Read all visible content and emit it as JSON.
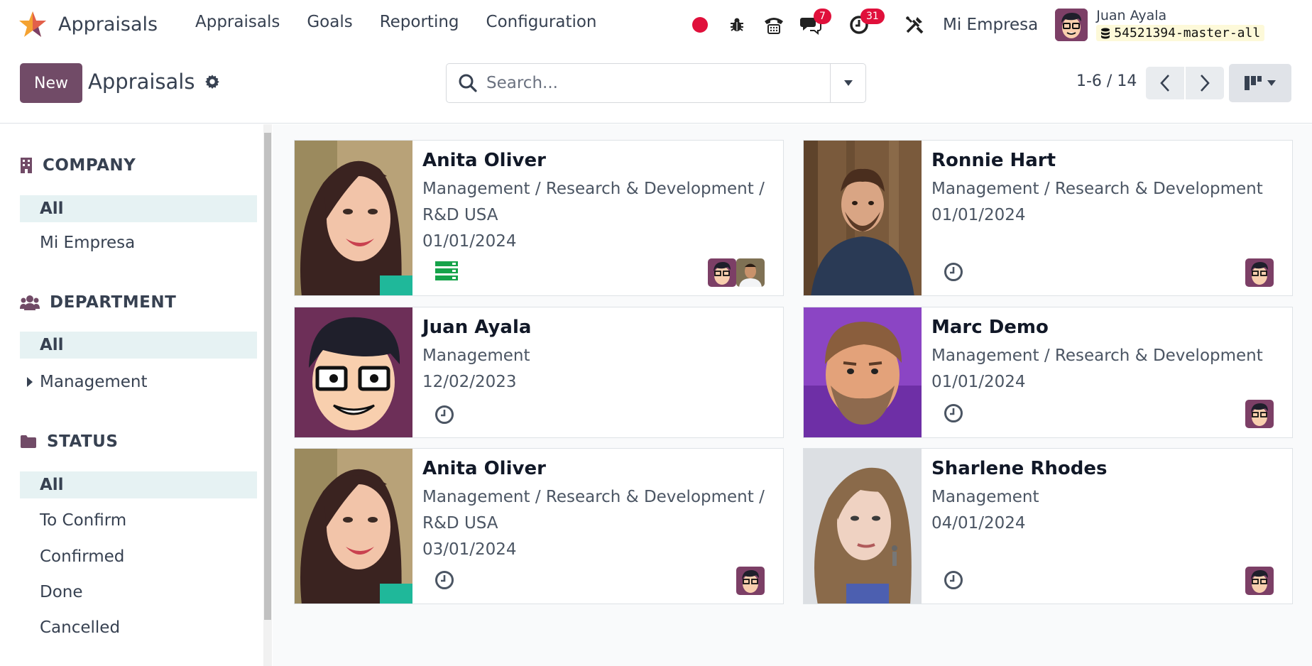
{
  "navbar": {
    "app_name": "Appraisals",
    "menu": [
      "Appraisals",
      "Goals",
      "Reporting",
      "Configuration"
    ],
    "messages_count": "7",
    "activities_count": "31",
    "company": "Mi Empresa",
    "user_name": "Juan Ayala",
    "database": "54521394-master-all"
  },
  "control": {
    "new_label": "New",
    "title": "Appraisals",
    "search_placeholder": "Search...",
    "pager": "1-6 / 14"
  },
  "sidebar": {
    "company": {
      "title": "COMPANY",
      "items": [
        "All",
        "Mi Empresa"
      ]
    },
    "department": {
      "title": "DEPARTMENT",
      "items": [
        "All",
        "Management"
      ]
    },
    "status": {
      "title": "STATUS",
      "items": [
        "All",
        "To Confirm",
        "Confirmed",
        "Done",
        "Cancelled"
      ]
    }
  },
  "cards": [
    {
      "name": "Anita Oliver",
      "dept1": "Management / Research & Development /",
      "dept2": "R&D USA",
      "date": "01/01/2024"
    },
    {
      "name": "Ronnie Hart",
      "dept1": "Management / Research & Development",
      "date": "01/01/2024"
    },
    {
      "name": "Juan Ayala",
      "dept1": "Management",
      "date": "12/02/2023"
    },
    {
      "name": "Marc Demo",
      "dept1": "Management / Research & Development",
      "date": "01/01/2024"
    },
    {
      "name": "Anita Oliver",
      "dept1": "Management / Research & Development /",
      "dept2": "R&D USA",
      "date": "03/01/2024"
    },
    {
      "name": "Sharlene Rhodes",
      "dept1": "Management",
      "date": "04/01/2024"
    }
  ],
  "colors": {
    "brand": "#714b67",
    "active_facet": "#e6f2f3",
    "badge": "#e0103b"
  }
}
